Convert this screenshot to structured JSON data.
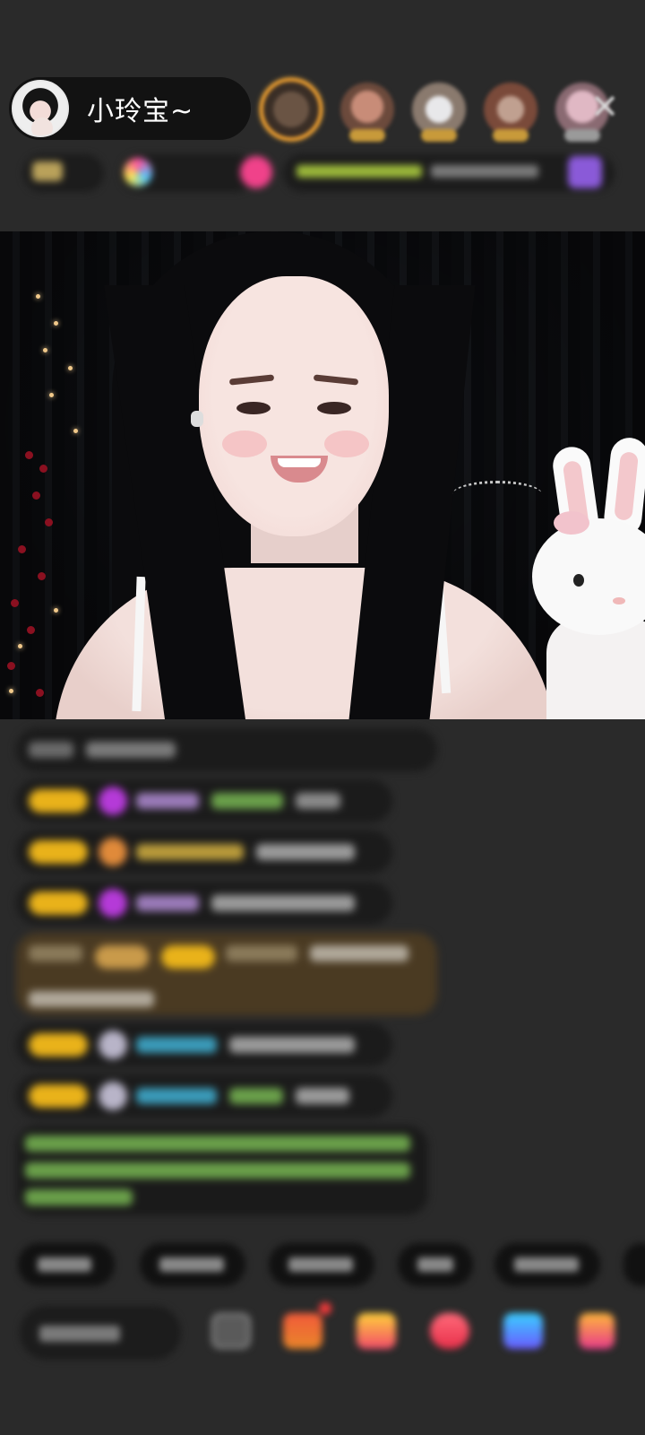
{
  "header": {
    "host_name": "小玲宝~",
    "close_icon": "close-icon",
    "viewer_icons": [
      "viewer-avatar-1",
      "viewer-avatar-2",
      "viewer-avatar-3",
      "viewer-avatar-4",
      "viewer-avatar-5"
    ]
  },
  "video": {
    "icon": "live-video-stream"
  },
  "chat": {
    "blurred": true,
    "message_count": 8
  },
  "quick_replies": {
    "blurred": true,
    "chip_count": 6
  },
  "toolbar": {
    "icons": [
      "comment-input",
      "emoji-icon",
      "gift-box-icon",
      "gift-icon",
      "heart-icon",
      "game-icon",
      "grid-icon"
    ],
    "has_notification_dot": true
  },
  "colors": {
    "background": "#2a2a2a",
    "pill": "#121212",
    "badge": "#e9b21a",
    "highlight_message": "#4a3a22",
    "top_viewer_border": "#f0a030",
    "notification": "#f23a3a"
  }
}
